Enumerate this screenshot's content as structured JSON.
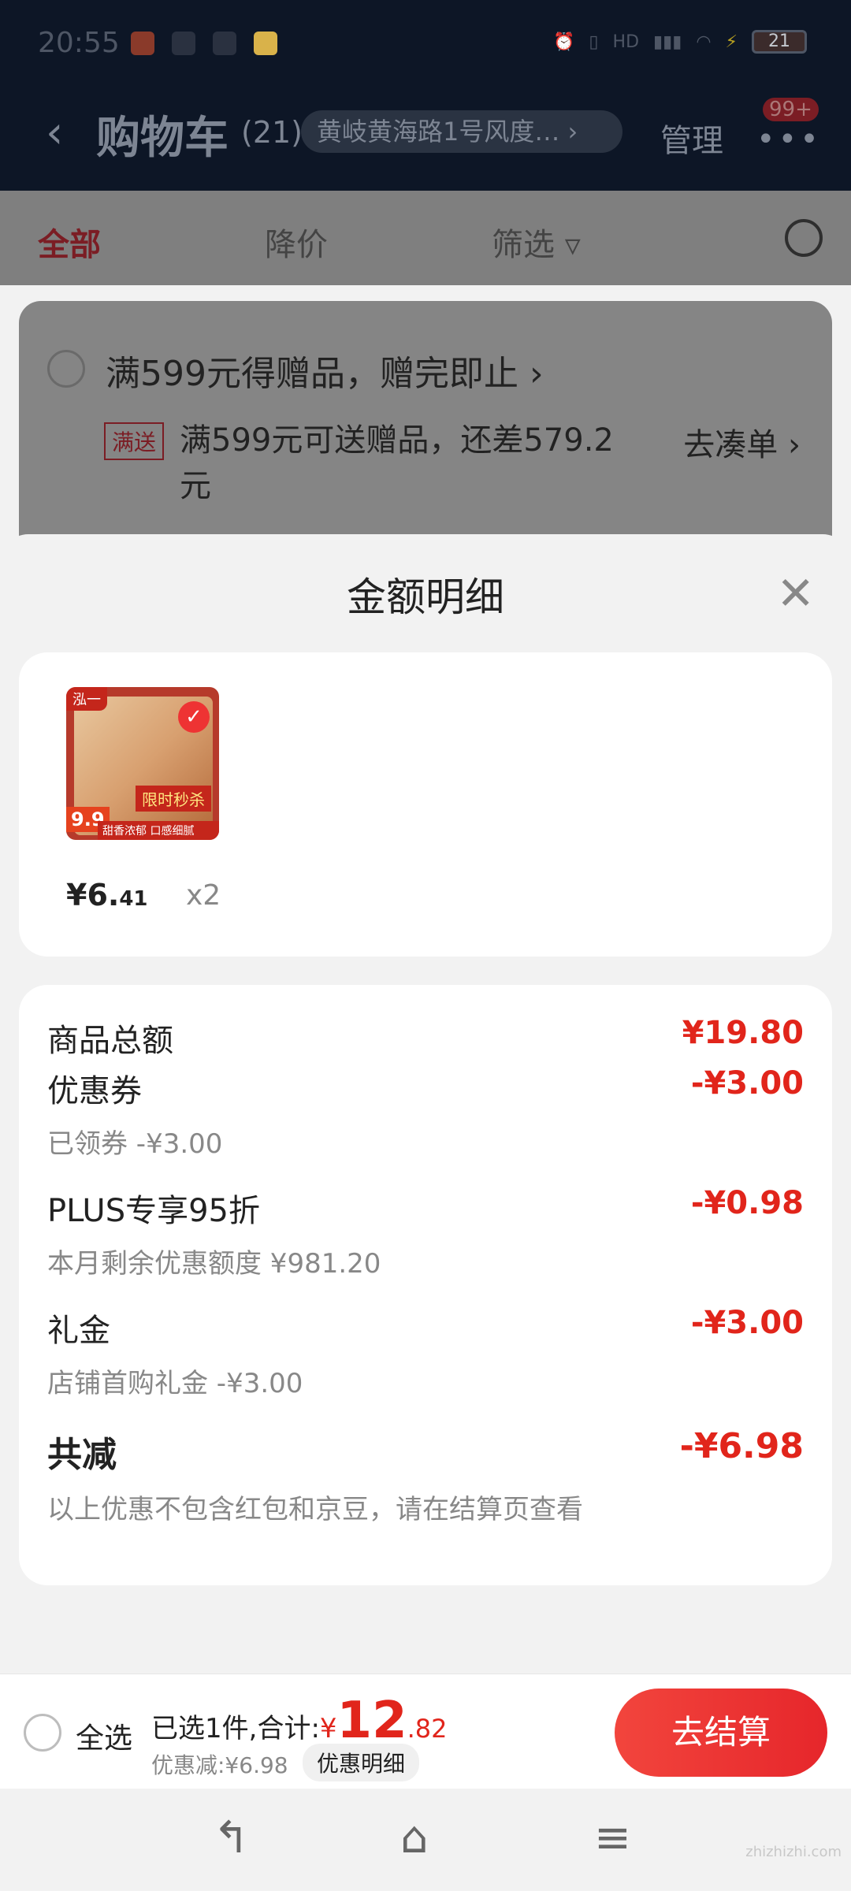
{
  "status_bar": {
    "time": "20:55",
    "battery": "21"
  },
  "header": {
    "back_icon": "chevron-left-icon",
    "title": "购物车",
    "count": "(21)",
    "address": "黄岐黄海路1号风度… ›",
    "manage": "管理",
    "more_icon": "more-dots-icon",
    "badge": "99+"
  },
  "tabs": {
    "all": "全部",
    "price_drop": "降价",
    "filter": "筛选 ▿",
    "search_icon": "search-icon"
  },
  "promo": {
    "gift_line": "满599元得赠品，赠完即止 ›",
    "tag": "满送",
    "gift_desc": "满599元可送赠品，还差579.2元",
    "gather": "去凑单 ›"
  },
  "sheet": {
    "title": "金额明细",
    "close_icon": "close-icon",
    "product": {
      "thumb_top": "泓一",
      "thumb_price": "9.9",
      "thumb_flash": "限时秒杀",
      "thumb_strip": "甜香浓郁 口感细腻",
      "price_int": "¥6.",
      "price_dec": "41",
      "qty": "x2"
    },
    "details": {
      "total_label": "商品总额",
      "total_amount": "¥19.80",
      "coupon_label": "优惠券",
      "coupon_sub": "已领券 -¥3.00",
      "coupon_amount": "-¥3.00",
      "plus_label": "PLUS专享95折",
      "plus_sub": "本月剩余优惠额度 ¥981.20",
      "plus_amount": "-¥0.98",
      "gift_label": "礼金",
      "gift_sub": "店铺首购礼金 -¥3.00",
      "gift_amount": "-¥3.00",
      "reduce_label": "共减",
      "reduce_sub": "以上优惠不包含红包和京豆，请在结算页查看",
      "reduce_amount": "-¥6.98"
    }
  },
  "bottom_bar": {
    "select_all": "全选",
    "summary_prefix": "已选1件,合计:",
    "yen": "¥",
    "total_int": "12",
    "total_dec": ".82",
    "discount": "优惠减:¥6.98",
    "detail_button": "优惠明细",
    "checkout": "去结算"
  },
  "nav": {
    "back_icon": "back-nav-icon",
    "home_icon": "home-nav-icon",
    "menu_icon": "menu-nav-icon"
  },
  "watermark": "zhizhizhi.com"
}
